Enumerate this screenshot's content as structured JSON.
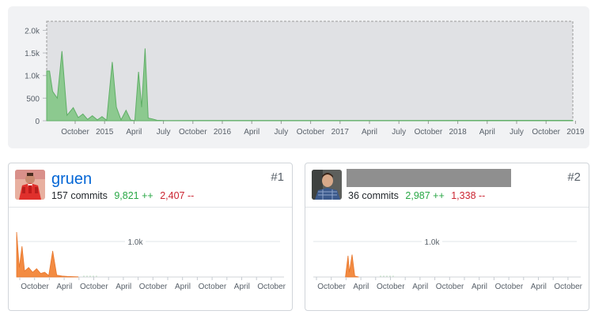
{
  "overview": {
    "chart_data": {
      "type": "area",
      "y_ticks": [
        "2.0k",
        "1.5k",
        "1.0k",
        "500",
        "0"
      ],
      "ylim": [
        0,
        2200
      ],
      "x_tick_labels": [
        "October",
        "2015",
        "April",
        "July",
        "October",
        "2016",
        "April",
        "July",
        "October",
        "2017",
        "April",
        "July",
        "October",
        "2018",
        "April",
        "July",
        "October",
        "2019"
      ],
      "x_range": [
        "2014-06",
        "2019-01"
      ],
      "series": [
        {
          "values": [
            {
              "x": "2014-06-10",
              "y": 1100
            },
            {
              "x": "2014-06-20",
              "y": 650
            },
            {
              "x": "2014-07-05",
              "y": 500
            },
            {
              "x": "2014-07-20",
              "y": 1540
            },
            {
              "x": "2014-08-05",
              "y": 120
            },
            {
              "x": "2014-08-25",
              "y": 290
            },
            {
              "x": "2014-09-10",
              "y": 70
            },
            {
              "x": "2014-09-25",
              "y": 150
            },
            {
              "x": "2014-10-10",
              "y": 30
            },
            {
              "x": "2014-10-25",
              "y": 110
            },
            {
              "x": "2014-11-10",
              "y": 20
            },
            {
              "x": "2014-11-25",
              "y": 90
            },
            {
              "x": "2014-12-10",
              "y": 10
            },
            {
              "x": "2014-12-28",
              "y": 1300
            },
            {
              "x": "2015-01-10",
              "y": 300
            },
            {
              "x": "2015-01-25",
              "y": 20
            },
            {
              "x": "2015-02-10",
              "y": 230
            },
            {
              "x": "2015-02-25",
              "y": 15
            },
            {
              "x": "2015-03-10",
              "y": 5
            },
            {
              "x": "2015-03-22",
              "y": 1080
            },
            {
              "x": "2015-04-01",
              "y": 300
            },
            {
              "x": "2015-04-12",
              "y": 1600
            },
            {
              "x": "2015-04-22",
              "y": 60
            },
            {
              "x": "2015-05-05",
              "y": 40
            },
            {
              "x": "2015-05-20",
              "y": 10
            },
            {
              "x": "2015-06-15",
              "y": 5
            }
          ]
        }
      ],
      "colors": {
        "fill": "#8cc98f",
        "stroke": "#5fae66",
        "plot_bg": "#e0e1e4",
        "border": "#9a9a9a"
      }
    }
  },
  "contributors": [
    {
      "name": "gruen",
      "rank": "#1",
      "commits": "157 commits",
      "additions": "9,821 ++",
      "deletions": "2,407 --",
      "avatar_icon": "red-suit-person-avatar",
      "chart_data": {
        "type": "area",
        "ylabel_tick": "1.0k",
        "x_tick_labels": [
          "October",
          "April",
          "October",
          "April",
          "October",
          "April",
          "October",
          "April",
          "October"
        ],
        "series": [
          {
            "values": [
              {
                "x": 0.0,
                "y": 1900
              },
              {
                "x": 0.01,
                "y": 400
              },
              {
                "x": 0.02,
                "y": 1300
              },
              {
                "x": 0.03,
                "y": 250
              },
              {
                "x": 0.045,
                "y": 400
              },
              {
                "x": 0.06,
                "y": 200
              },
              {
                "x": 0.075,
                "y": 350
              },
              {
                "x": 0.09,
                "y": 150
              },
              {
                "x": 0.105,
                "y": 200
              },
              {
                "x": 0.12,
                "y": 60
              },
              {
                "x": 0.135,
                "y": 1100
              },
              {
                "x": 0.15,
                "y": 80
              },
              {
                "x": 0.17,
                "y": 40
              },
              {
                "x": 0.19,
                "y": 25
              },
              {
                "x": 0.21,
                "y": 15
              },
              {
                "x": 0.23,
                "y": 5
              }
            ]
          }
        ],
        "colors": {
          "fill": "#f38b42",
          "stroke": "#e8762b"
        }
      }
    },
    {
      "name": "",
      "rank": "#2",
      "commits": "36 commits",
      "additions": "2,987 ++",
      "deletions": "1,338 --",
      "avatar_icon": "man-in-plaid-shirt-avatar",
      "chart_data": {
        "type": "area",
        "ylabel_tick": "1.0k",
        "x_tick_labels": [
          "October",
          "April",
          "October",
          "April",
          "October",
          "April",
          "October",
          "April",
          "October"
        ],
        "series": [
          {
            "values": [
              {
                "x": 0.12,
                "y": 0
              },
              {
                "x": 0.13,
                "y": 900
              },
              {
                "x": 0.135,
                "y": 200
              },
              {
                "x": 0.145,
                "y": 950
              },
              {
                "x": 0.155,
                "y": 40
              },
              {
                "x": 0.17,
                "y": 0
              }
            ]
          }
        ],
        "colors": {
          "fill": "#f38b42",
          "stroke": "#e8762b"
        }
      }
    }
  ]
}
